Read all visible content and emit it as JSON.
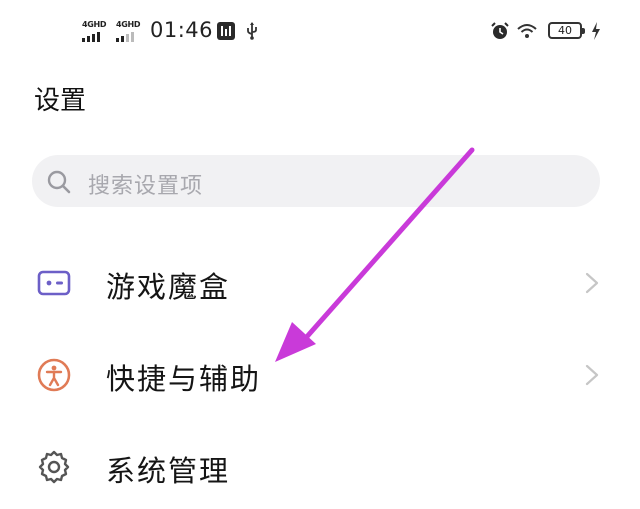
{
  "status_bar": {
    "sim1_network": "4GHD",
    "sim2_network": "4GHD",
    "sim1_signal_bars": 4,
    "sim2_signal_bars": 2,
    "time": "01:46",
    "battery": "40",
    "icons": [
      "signal-icon",
      "signal-icon",
      "network-speed-icon",
      "usb-icon",
      "alarm-icon",
      "wifi-icon",
      "battery-icon",
      "charging-icon"
    ]
  },
  "page": {
    "title": "设置"
  },
  "search": {
    "placeholder": "搜索设置项"
  },
  "menu": {
    "items": [
      {
        "label": "游戏魔盒",
        "icon": "game-box-icon",
        "icon_color": "#6c5fc7"
      },
      {
        "label": "快捷与辅助",
        "icon": "accessibility-icon",
        "icon_color": "#e07b56"
      },
      {
        "label": "系统管理",
        "icon": "gear-icon",
        "icon_color": "#555555"
      }
    ]
  },
  "annotation": {
    "arrow_color": "#c93ad9"
  }
}
